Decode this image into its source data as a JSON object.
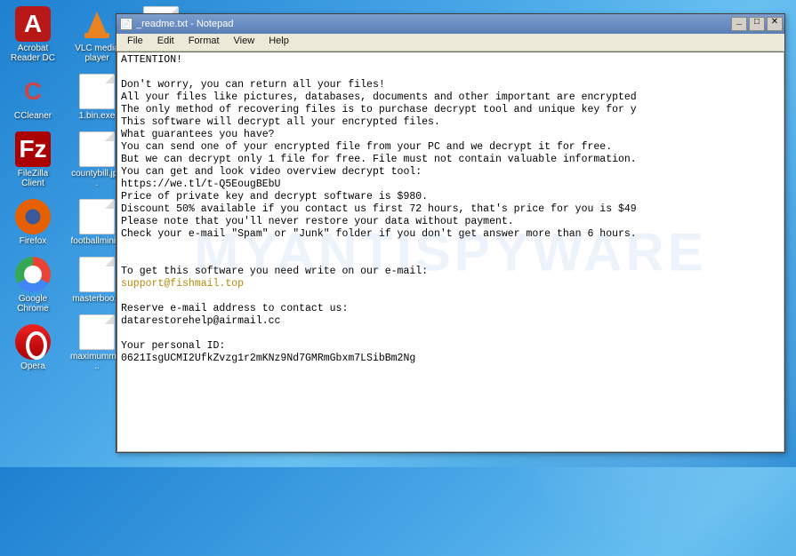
{
  "desktop": {
    "columns": [
      [
        {
          "name": "acrobat",
          "label": "Acrobat Reader DC",
          "cls": "ic-adobe",
          "glyph": "A"
        },
        {
          "name": "ccleaner",
          "label": "CCleaner",
          "cls": "ic-ccleaner",
          "glyph": "C"
        },
        {
          "name": "filezilla",
          "label": "FileZilla Client",
          "cls": "ic-filezilla",
          "glyph": "Fz"
        },
        {
          "name": "firefox",
          "label": "Firefox",
          "cls": "ic-firefox",
          "glyph": ""
        },
        {
          "name": "chrome",
          "label": "Google Chrome",
          "cls": "ic-chrome",
          "glyph": ""
        },
        {
          "name": "opera",
          "label": "Opera",
          "cls": "ic-opera",
          "glyph": ""
        }
      ],
      [
        {
          "name": "vlc",
          "label": "VLC media player",
          "cls": "ic-vlc",
          "glyph": ""
        },
        {
          "name": "file-1bin",
          "label": "1.bin.exe",
          "cls": "ic-file",
          "glyph": ""
        },
        {
          "name": "file-countybill",
          "label": "countybill.jp...",
          "cls": "ic-file",
          "glyph": ""
        },
        {
          "name": "file-footballmini",
          "label": "footballmini...",
          "cls": "ic-file",
          "glyph": ""
        },
        {
          "name": "file-masterboo",
          "label": "masterboo...",
          "cls": "ic-file",
          "glyph": ""
        },
        {
          "name": "file-maximumma",
          "label": "maximumma...",
          "cls": "ic-file",
          "glyph": ""
        }
      ],
      [
        {
          "name": "file-readme",
          "label": "",
          "cls": "ic-file",
          "glyph": ""
        }
      ]
    ]
  },
  "notepad": {
    "title": "_readme.txt - Notepad",
    "menu": [
      "File",
      "Edit",
      "Format",
      "View",
      "Help"
    ],
    "buttons": {
      "min": "_",
      "max": "□",
      "close": "✕"
    },
    "body_lines": [
      {
        "t": "ATTENTION!"
      },
      {
        "t": ""
      },
      {
        "t": "Don't worry, you can return all your files!"
      },
      {
        "t": "All your files like pictures, databases, documents and other important are encrypted"
      },
      {
        "t": "The only method of recovering files is to purchase decrypt tool and unique key for y"
      },
      {
        "t": "This software will decrypt all your encrypted files."
      },
      {
        "t": "What guarantees you have?"
      },
      {
        "t": "You can send one of your encrypted file from your PC and we decrypt it for free."
      },
      {
        "t": "But we can decrypt only 1 file for free. File must not contain valuable information."
      },
      {
        "t": "You can get and look video overview decrypt tool:"
      },
      {
        "t": "https://we.tl/t-Q5EougBEbU"
      },
      {
        "t": "Price of private key and decrypt software is $980."
      },
      {
        "t": "Discount 50% available if you contact us first 72 hours, that's price for you is $49"
      },
      {
        "t": "Please note that you'll never restore your data without payment."
      },
      {
        "t": "Check your e-mail \"Spam\" or \"Junk\" folder if you don't get answer more than 6 hours."
      },
      {
        "t": ""
      },
      {
        "t": ""
      },
      {
        "t": "To get this software you need write on our e-mail:"
      },
      {
        "t": "support@fishmail.top",
        "hl": true
      },
      {
        "t": ""
      },
      {
        "t": "Reserve e-mail address to contact us:"
      },
      {
        "t": "datarestorehelp@airmail.cc"
      },
      {
        "t": ""
      },
      {
        "t": "Your personal ID:"
      },
      {
        "t": "0621IsgUCMI2UfkZvzg1r2mKNz9Nd7GMRmGbxm7LSibBm2Ng"
      }
    ]
  },
  "watermark": "MYANTISPYWARE"
}
